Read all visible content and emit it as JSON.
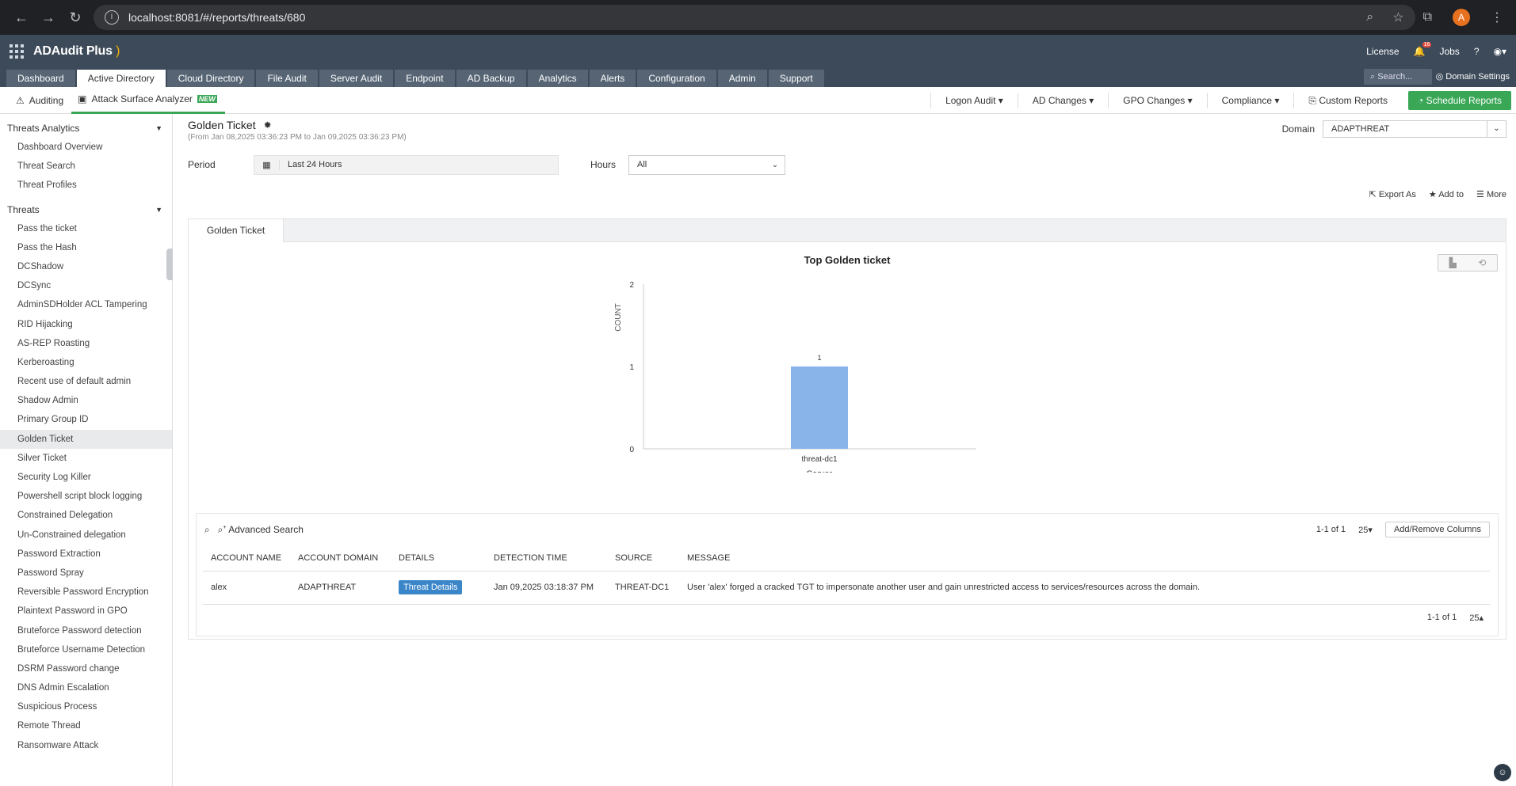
{
  "browser": {
    "url": "localhost:8081/#/reports/threats/680",
    "avatar": "A"
  },
  "app": {
    "name": "ADAudit Plus",
    "top_links": {
      "license": "License",
      "notif_count": "16",
      "jobs": "Jobs",
      "help": "?"
    },
    "tabs": [
      "Dashboard",
      "Active Directory",
      "Cloud Directory",
      "File Audit",
      "Server Audit",
      "Endpoint",
      "AD Backup",
      "Analytics",
      "Alerts",
      "Configuration",
      "Admin",
      "Support"
    ],
    "search_placeholder": "Search...",
    "domain_settings": "Domain Settings"
  },
  "subnav": {
    "auditing": "Auditing",
    "attack_surface": "Attack Surface Analyzer",
    "new_badge": "NEW",
    "menus": [
      "Logon Audit",
      "AD Changes",
      "GPO Changes",
      "Compliance"
    ],
    "custom_reports": "Custom Reports",
    "schedule_reports": "Schedule Reports"
  },
  "sidebar": {
    "sections": [
      {
        "title": "Threats Analytics",
        "items": [
          "Dashboard Overview",
          "Threat Search",
          "Threat Profiles"
        ]
      },
      {
        "title": "Threats",
        "items": [
          "Pass the ticket",
          "Pass the Hash",
          "DCShadow",
          "DCSync",
          "AdminSDHolder ACL Tampering",
          "RID Hijacking",
          "AS-REP Roasting",
          "Kerberoasting",
          "Recent use of default admin",
          "Shadow Admin",
          "Primary Group ID",
          "Golden Ticket",
          "Silver Ticket",
          "Security Log Killer",
          "Powershell script block logging",
          "Constrained Delegation",
          "Un-Constrained delegation",
          "Password Extraction",
          "Password Spray",
          "Reversible Password Encryption",
          "Plaintext Password in GPO",
          "Bruteforce Password detection",
          "Bruteforce Username Detection",
          "DSRM Password change",
          "DNS Admin Escalation",
          "Suspicious Process",
          "Remote Thread",
          "Ransomware Attack"
        ]
      }
    ],
    "selected": "Golden Ticket"
  },
  "report": {
    "title": "Golden Ticket",
    "date_range": "(From Jan 08,2025 03:36:23 PM to Jan 09,2025 03:36:23 PM)",
    "domain_label": "Domain",
    "domain_value": "ADAPTHREAT",
    "period_label": "Period",
    "period_value": "Last 24 Hours",
    "hours_label": "Hours",
    "hours_value": "All",
    "actions": {
      "export": "Export As",
      "add_to": "Add to",
      "more": "More"
    },
    "tab": "Golden Ticket"
  },
  "chart_data": {
    "type": "bar",
    "title": "Top Golden ticket",
    "categories": [
      "threat-dc1"
    ],
    "values": [
      1
    ],
    "xlabel": "Server",
    "ylabel": "COUNT",
    "ylim": [
      0,
      2
    ],
    "yticks": [
      0,
      1,
      2
    ],
    "bar_color": "#89b4ea",
    "data_labels": [
      "1"
    ]
  },
  "table": {
    "advanced_search": "Advanced Search",
    "pagination": "1-1 of 1",
    "page_size": "25",
    "add_remove": "Add/Remove Columns",
    "columns": [
      "ACCOUNT NAME",
      "ACCOUNT DOMAIN",
      "DETAILS",
      "DETECTION TIME",
      "SOURCE",
      "MESSAGE"
    ],
    "rows": [
      {
        "account_name": "alex",
        "account_domain": "ADAPTHREAT",
        "details": "Threat Details",
        "detection_time": "Jan 09,2025 03:18:37 PM",
        "source": "THREAT-DC1",
        "message": "User 'alex' forged a cracked TGT to impersonate another user and gain unrestricted access to services/resources across the domain."
      }
    ]
  }
}
